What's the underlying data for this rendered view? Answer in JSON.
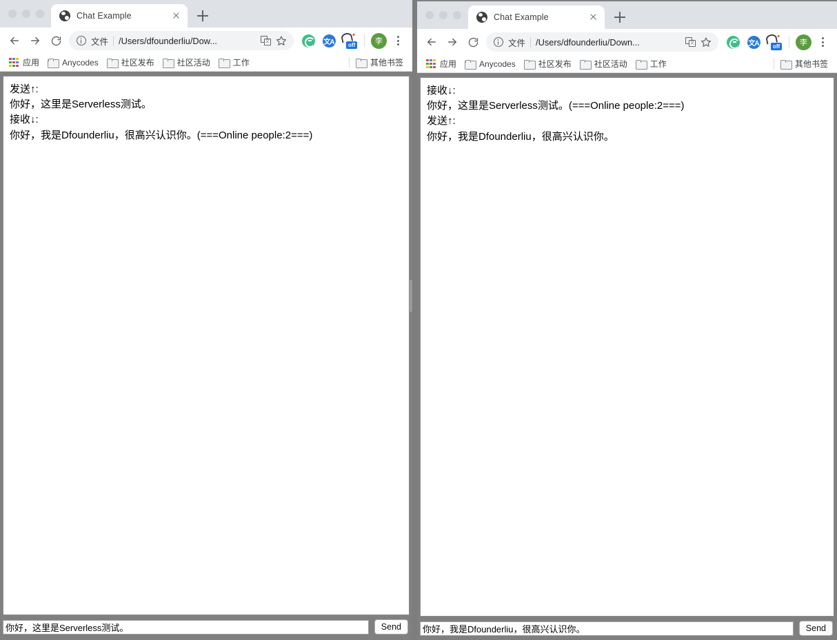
{
  "windows": [
    {
      "id": "left",
      "tab": {
        "title": "Chat Example",
        "favicon": "globe-icon",
        "close": "close-icon"
      },
      "newtab_label": "+",
      "toolbar": {
        "back": "back-arrow-icon",
        "forward": "forward-arrow-icon",
        "reload": "reload-icon",
        "info": "info-circle-icon",
        "scheme_label": "文件",
        "url": "/Users/dfounderliu/Dow...",
        "translate": "translate-page-icon",
        "bookmark_star": "star-icon",
        "extensions": [
          "grammarly-ext-icon",
          "translate-ext-icon",
          "adblock-off-ext-icon"
        ],
        "avatar_letter": "李",
        "menu": "kebab-menu-icon"
      },
      "bookmarks": {
        "apps_label": "应用",
        "items": [
          "Anycodes",
          "社区发布",
          "社区活动",
          "工作"
        ],
        "other_label": "其他书签"
      },
      "page": {
        "chat_lines": [
          "发送↑:",
          "你好，这里是Serverless测试。",
          "接收↓:",
          "你好，我是Dfounderliu，很高兴认识你。(===Online people:2===)"
        ],
        "input_value": "你好，这里是Serverless测试。",
        "input_placeholder": "",
        "send_label": "Send"
      }
    },
    {
      "id": "right",
      "tab": {
        "title": "Chat Example",
        "favicon": "globe-icon",
        "close": "close-icon"
      },
      "newtab_label": "+",
      "toolbar": {
        "back": "back-arrow-icon",
        "forward": "forward-arrow-icon",
        "reload": "reload-icon",
        "info": "info-circle-icon",
        "scheme_label": "文件",
        "url": "/Users/dfounderliu/Down...",
        "translate": "translate-page-icon",
        "bookmark_star": "star-icon",
        "extensions": [
          "grammarly-ext-icon",
          "translate-ext-icon",
          "adblock-off-ext-icon"
        ],
        "avatar_letter": "李",
        "menu": "kebab-menu-icon"
      },
      "bookmarks": {
        "apps_label": "应用",
        "items": [
          "Anycodes",
          "社区发布",
          "社区活动",
          "工作"
        ],
        "other_label": "其他书签"
      },
      "page": {
        "chat_lines": [
          "接收↓:",
          "你好，这里是Serverless测试。(===Online people:2===)",
          "发送↑:",
          "你好，我是Dfounderliu，很高兴认识你。"
        ],
        "input_value": "你好，我是Dfounderliu，很高兴认识你。",
        "input_placeholder": "",
        "send_label": "Send"
      }
    }
  ],
  "colors": {
    "chrome_frame": "#dee1e6",
    "toolbar_bg": "#ffffff",
    "page_bg": "#808080",
    "chat_bg": "#ffffff",
    "avatar": "#5c9b3e",
    "ext_green": "#3fbf87",
    "ext_blue": "#2c7ad6",
    "off_badge": "#1a73e8"
  }
}
